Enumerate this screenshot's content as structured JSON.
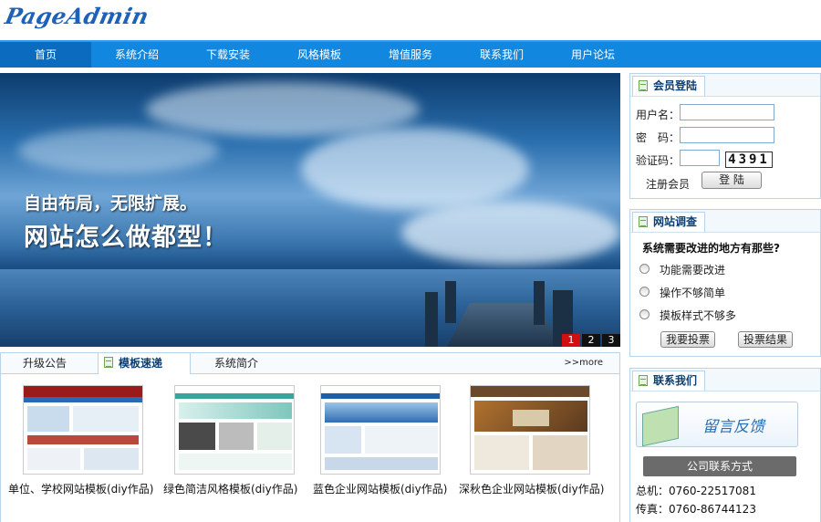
{
  "header": {
    "logo_text": "PageAdmin"
  },
  "nav": {
    "items": [
      {
        "label": "首页",
        "active": true
      },
      {
        "label": "系统介绍"
      },
      {
        "label": "下载安装"
      },
      {
        "label": "风格模板"
      },
      {
        "label": "增值服务"
      },
      {
        "label": "联系我们"
      },
      {
        "label": "用户论坛"
      }
    ]
  },
  "banner": {
    "line1": "自由布局，无限扩展。",
    "line2": "网站怎么做都型！",
    "slides": [
      "1",
      "2",
      "3"
    ],
    "active_slide": "1"
  },
  "login": {
    "title": "会员登陆",
    "username_label": "用户名：",
    "password_label": "密　码：",
    "captcha_label": "验证码：",
    "captcha_text": "4391",
    "register_label": "注册会员",
    "login_button": "登 陆"
  },
  "survey": {
    "title": "网站调查",
    "question": "系统需要改进的地方有那些?",
    "options": [
      "功能需要改进",
      "操作不够简单",
      "摸板样式不够多"
    ],
    "vote_button": "我要投票",
    "result_button": "投票结果"
  },
  "tabs": {
    "items": [
      {
        "label": "升级公告"
      },
      {
        "label": "模板速递",
        "active": true
      },
      {
        "label": "系统简介"
      }
    ],
    "more_label": ">>more"
  },
  "templates": [
    {
      "caption": "单位、学校网站模板(diy作品)"
    },
    {
      "caption": "绿色简洁风格模板(diy作品)"
    },
    {
      "caption": "蓝色企业网站模板(diy作品)"
    },
    {
      "caption": "深秋色企业网站模板(diy作品)"
    }
  ],
  "contact": {
    "title": "联系我们",
    "feedback_label": "留言反馈",
    "company_button": "公司联系方式",
    "phone": "总机：0760-22517081",
    "fax": "传真：0760-86744123"
  },
  "colors": {
    "nav_bg": "#1187e0",
    "nav_active": "#0a6bbf",
    "panel_border": "#b9d3e8",
    "title_color": "#0b3f73"
  }
}
